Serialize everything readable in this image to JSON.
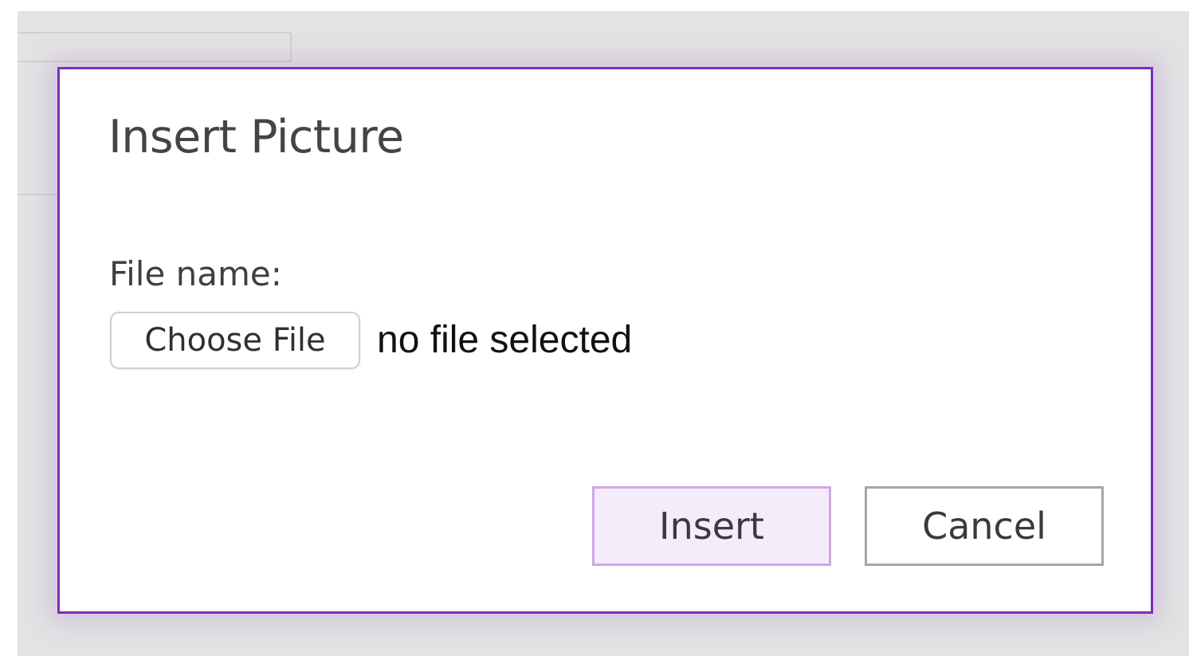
{
  "dialog": {
    "title": "Insert Picture",
    "file_label": "File name:",
    "choose_file_label": "Choose File",
    "file_status": "no file selected",
    "insert_label": "Insert",
    "cancel_label": "Cancel"
  },
  "colors": {
    "dialog_border": "#7a2dbf",
    "insert_background": "#f4ecfb",
    "insert_border": "#cfa8e8",
    "cancel_border": "#a6a6a6",
    "backdrop": "#e3e3e3"
  }
}
